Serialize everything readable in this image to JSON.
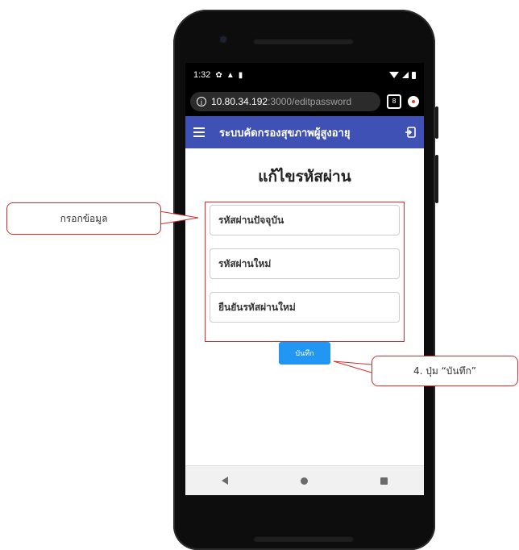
{
  "status_bar": {
    "time": "1:32"
  },
  "browser": {
    "url_host": "10.80.34.192",
    "url_path": ":3000/editpassword",
    "tab_count": "8"
  },
  "app_bar": {
    "title": "ระบบคัดกรองสุขภาพผู้สูงอายุ"
  },
  "page": {
    "title": "แก้ไขรหัสผ่าน",
    "fields": [
      {
        "placeholder": "รหัสผ่านปัจจุบัน"
      },
      {
        "placeholder": "รหัสผ่านใหม่"
      },
      {
        "placeholder": "ยืนยันรหัสผ่านใหม่"
      }
    ],
    "save_label": "บันทึก"
  },
  "annotations": {
    "callout_fill": "กรอกข้อมูล",
    "callout_save": "4. ปุ่ม “บันทึก”",
    "accent_color": "#d32f2f"
  },
  "colors": {
    "app_bar": "#3f51b5",
    "button": "#2196f3"
  }
}
